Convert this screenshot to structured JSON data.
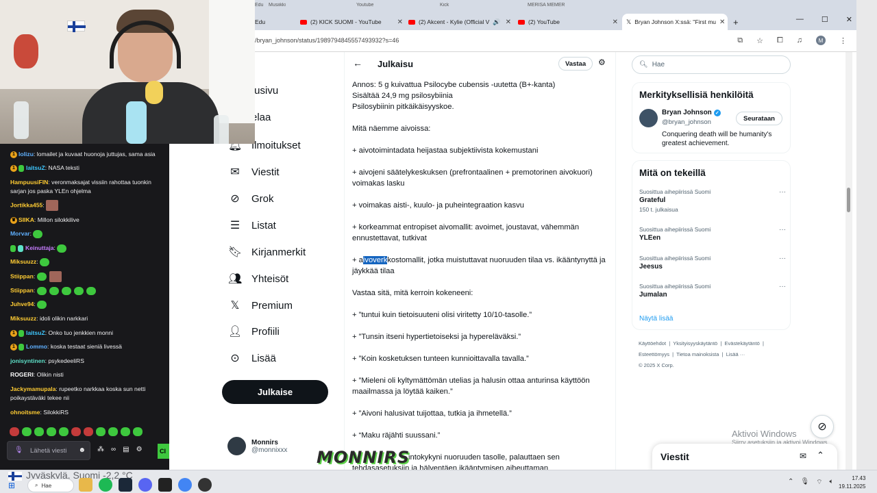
{
  "browser": {
    "top_tabs": [
      "Edu",
      "Musiikki",
      "Youtube",
      "Kick",
      "MERISA MEMER"
    ],
    "tabs": [
      {
        "label": "Edu"
      },
      {
        "label": "(2) KICK SUOMI - YouTube"
      },
      {
        "label": "(2) Akcent - Kylie (Official V"
      },
      {
        "label": "(2) YouTube"
      },
      {
        "label": "Bryan Johnson X:ssä: \"First mu"
      }
    ],
    "url": "/bryan_johnson/status/1989794845557493932?s=46"
  },
  "x": {
    "nav": [
      {
        "label": "tusivu",
        "icon": "home"
      },
      {
        "label": "elaa",
        "icon": "explore"
      },
      {
        "label": "Ilmoitukset",
        "icon": "bell"
      },
      {
        "label": "Viestit",
        "icon": "mail"
      },
      {
        "label": "Grok",
        "icon": "grok"
      },
      {
        "label": "Listat",
        "icon": "list"
      },
      {
        "label": "Kirjanmerkit",
        "icon": "bookmark"
      },
      {
        "label": "Yhteisöt",
        "icon": "people"
      },
      {
        "label": "Premium",
        "icon": "x-logo"
      },
      {
        "label": "Profiili",
        "icon": "person"
      },
      {
        "label": "Lisää",
        "icon": "more"
      }
    ],
    "post_button": "Julkaise",
    "profile": {
      "name": "Monnirs",
      "handle": "@monnixxx"
    },
    "header": {
      "title": "Julkaisu",
      "reply": "Vastaa"
    },
    "post": {
      "lines": [
        "Annos: 5 g kuivattua Psilocybe cubensis -uutetta (B+-kanta)",
        "Sisältää 24,9 mg psilosybiinia",
        "Psilosybiinin pitkäikäisyyskoe."
      ],
      "p1": "Mitä näemme aivoissa:",
      "p2": "+ aivotoimintadata heijastaa subjektiivista kokemustani",
      "p3": "+ aivojeni säätelykeskuksen (prefrontaalinen + premotorinen aivokuori) voimakas lasku",
      "p4": "+ voimakas aisti-, kuulo- ja puheintegraation kasvu",
      "p5": "+ korkeammat entropiset aivomallit: avoimet, joustavat, vähemmän ennustettavat, tutkivat",
      "p6_pre": "+ a",
      "p6_hl": "ivoverk",
      "p6_post": "kostomallit, jotka muistuttavat nuoruuden tilaa vs. ikääntynyttä ja jäykkää tilaa",
      "p7": "Vastaa sitä, mitä kerroin kokeneeni:",
      "p8": "+ ”tuntui kuin tietoisuuteni olisi viritetty 10/10-tasolle.”",
      "p9": "+ ”Tunsin itseni hypertietoiseksi ja hypereläväksi.”",
      "p10": "+ ”Koin kosketuksen tunteen kunnioittavalla tavalla.”",
      "p11": "+ ”Mieleni oli kyltymättömän utelias ja halusin ottaa anturinsa käyttöön maailmassa ja löytää kaiken.”",
      "p12": "+ ”Aivoni halusivat tuijottaa, tutkia ja ihmetellä.”",
      "p13": "+ “Maku räjähti suussani.”",
      "p14": "intokykyni nuoruuden tasolle, palauttaen sen",
      "p15": "tehdasasetuksiin ja hälventäen ikääntymisen aiheuttaman"
    },
    "search_placeholder": "Hae",
    "who_to_follow": {
      "title": "Merkityksellisiä henkilöitä",
      "name": "Bryan Johnson",
      "handle": "@bryan_johnson",
      "bio": "Conquering death will be humanity's greatest achievement.",
      "follow": "Seurataan"
    },
    "trends": {
      "title": "Mitä on tekeillä",
      "items": [
        {
          "context": "Suosittua aihepiirissä Suomi",
          "title": "Grateful",
          "count": "150 t. julkaisua"
        },
        {
          "context": "Suosittua aihepiirissä Suomi",
          "title": "YLEen",
          "count": ""
        },
        {
          "context": "Suosittua aihepiirissä Suomi",
          "title": "Jeesus",
          "count": ""
        },
        {
          "context": "Suosittua aihepiirissä Suomi",
          "title": "Jumalan",
          "count": ""
        }
      ],
      "show_more": "Näytä lisää"
    },
    "footer": {
      "links": [
        "Käyttöehdot",
        "Yksityisyyskäytäntö",
        "Evästekäytäntö",
        "Esteettömyys",
        "Tietoa mainoksista",
        "Lisää ···"
      ],
      "copyright": "© 2025 X Corp."
    },
    "messages_drawer": "Viestit",
    "activate_windows": {
      "title": "Aktivoi Windows",
      "subtitle": "Siirry asetuksiin ja aktivoi Windows."
    }
  },
  "chat": {
    "messages": [
      {
        "user": "lolizu",
        "color": "#5fb0ff",
        "text": "lomailet ja kuvaat huonoja juttujas, sama asia",
        "badges": [
          "1"
        ]
      },
      {
        "user": "laitsuZ",
        "color": "#3ec8ff",
        "text": "NASA teksti",
        "badges": [
          "1",
          "sub"
        ]
      },
      {
        "user": "HampuusiFIN",
        "color": "#ffcc33",
        "text": "veronmaksajat vissiin rahottaa tuonkin sarjan jos paska YLEn ohjelma",
        "badges": []
      },
      {
        "user": "Jortikka455",
        "color": "#ffcc33",
        "text": "",
        "badges": [],
        "emotes": [
          "pic"
        ]
      },
      {
        "user": "SIIKA",
        "color": "#ffcc33",
        "text": "Millon silokkilive",
        "badges": [
          "crown"
        ]
      },
      {
        "user": "Morvar",
        "color": "#5fb0ff",
        "text": "",
        "badges": [],
        "emotes": [
          "g"
        ]
      },
      {
        "user": "Keinuttaja",
        "color": "#c77dff",
        "text": "",
        "badges": [
          "sub",
          "gift"
        ],
        "emotes": [
          "g"
        ]
      },
      {
        "user": "Miksuuzz",
        "color": "#ffcc33",
        "text": "",
        "badges": [],
        "emotes": [
          "g"
        ]
      },
      {
        "user": "Stiippan",
        "color": "#ffcc33",
        "text": "",
        "badges": [],
        "emotes": [
          "g",
          "pic"
        ]
      },
      {
        "user": "Stiippan",
        "color": "#ffcc33",
        "text": "",
        "badges": [],
        "emotes": [
          "g",
          "g",
          "g",
          "g",
          "g"
        ]
      },
      {
        "user": "Juhve94",
        "color": "#ffcc33",
        "text": "",
        "badges": [],
        "emotes": [
          "g"
        ]
      },
      {
        "user": "Miksuuzz",
        "color": "#ffcc33",
        "text": "idoli olikin narkkari",
        "badges": []
      },
      {
        "user": "laitsuZ",
        "color": "#3ec8ff",
        "text": "Onko tuo jenkkien monni",
        "badges": [
          "1",
          "sub"
        ]
      },
      {
        "user": "Lommo",
        "color": "#5fb0ff",
        "text": "koska testaat sieniä livessä",
        "badges": [
          "1",
          "sub"
        ]
      },
      {
        "user": "jonisyntinen",
        "color": "#5ee0c8",
        "text": "psykedeeliRS",
        "badges": []
      },
      {
        "user": "ROGERI",
        "color": "#ffffff",
        "text": "Olikin nisti",
        "badges": []
      },
      {
        "user": "Jackymamupala",
        "color": "#ffcc33",
        "text": "rupeetko narkkaa koska sun netti poikaystäväki tekee nii",
        "badges": []
      },
      {
        "user": "ohnoitsme",
        "color": "#ffcc33",
        "text": "SilokkiRS",
        "badges": []
      }
    ],
    "input_placeholder": "Lähetä viesti",
    "send_label": "Cl"
  },
  "overlay_logo": "MONNIRS",
  "taskbar": {
    "weather": "Jyväskylä, Suomi   -2,2 °C",
    "search": "Hae",
    "time": "17.43",
    "date": "19.11.2025",
    "big_time": "17.43"
  },
  "colors": {
    "x_accent": "#1d9bf0",
    "chat_bg": "#18181b",
    "kick_green": "#3ec83e"
  }
}
